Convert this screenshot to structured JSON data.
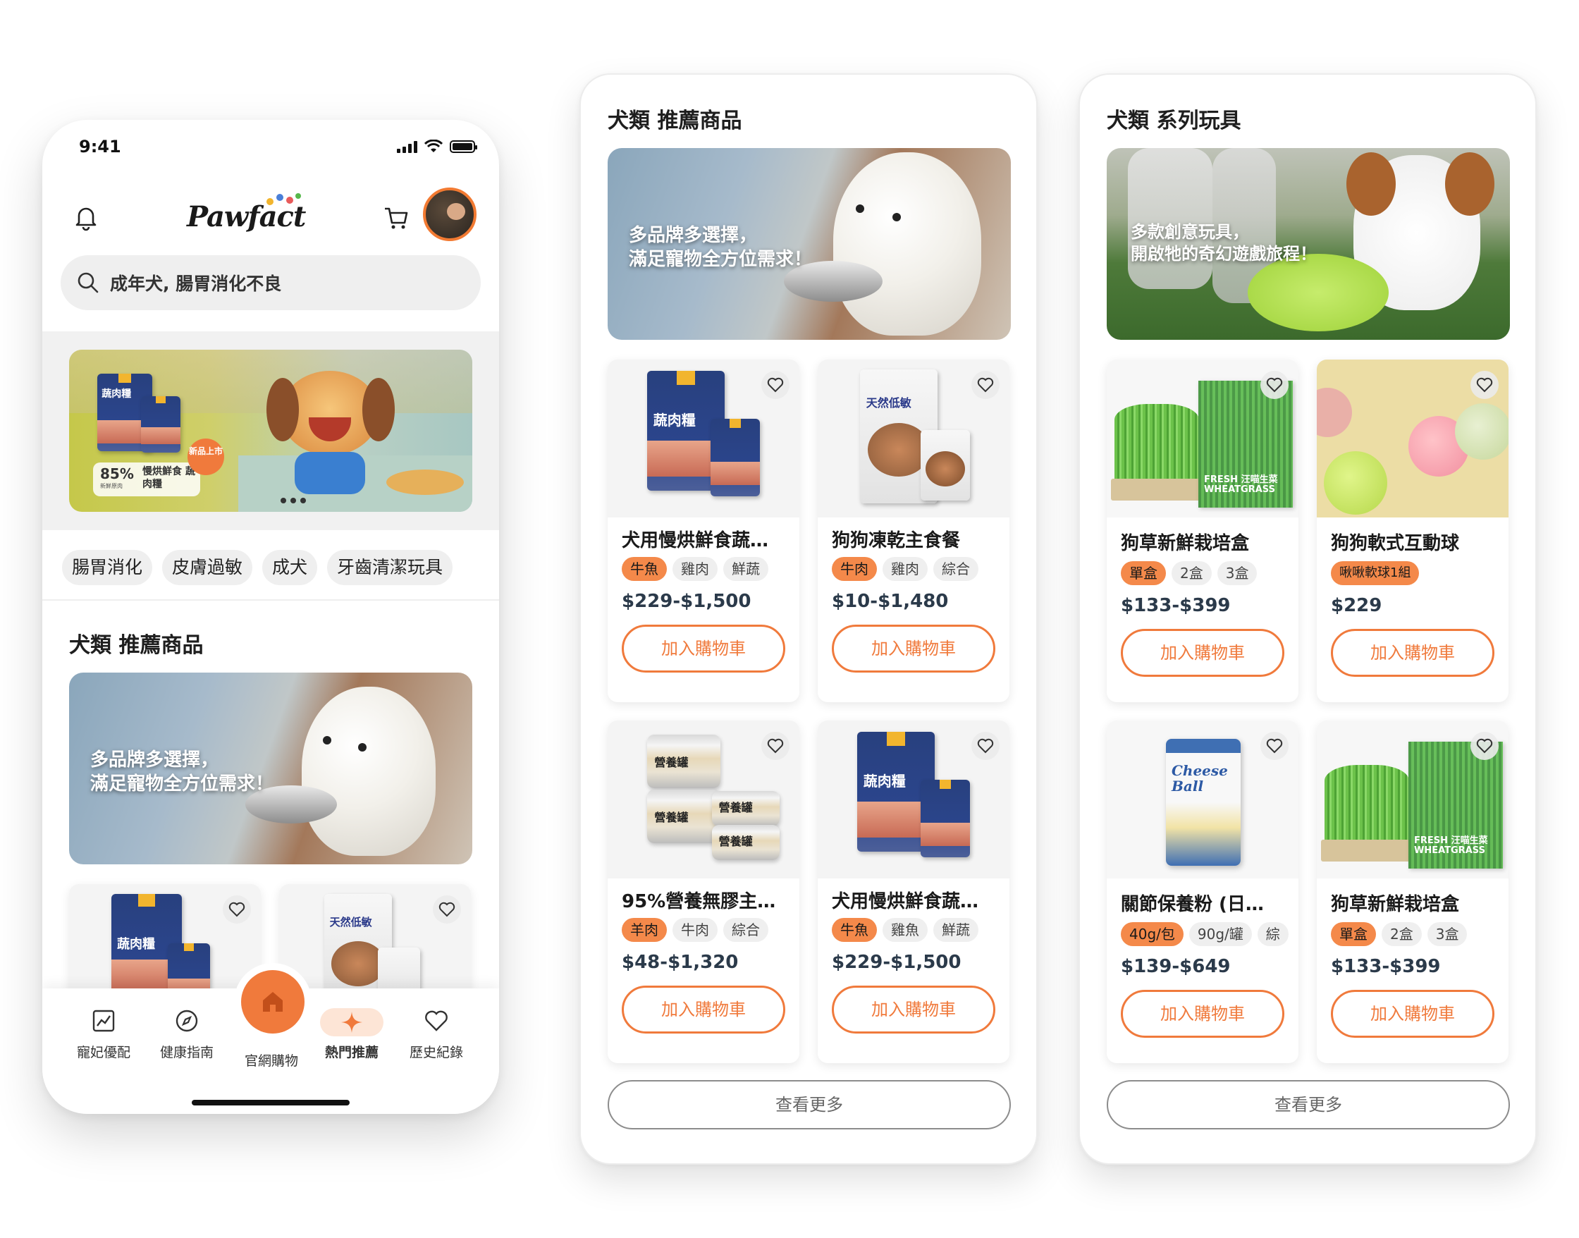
{
  "phone": {
    "status_time": "9:41",
    "logo": "Pawfact",
    "search_placeholder": "成年犬, 腸胃消化不良",
    "promo": {
      "pct": "85%",
      "small": "新鮮原肉",
      "name": "慢烘鮮食 蔬肉糧",
      "new_tag": "新品上市",
      "pkg_label": "蔬肉糧"
    },
    "chips": [
      "腸胃消化",
      "皮膚過敏",
      "成犬",
      "牙齒清潔玩具"
    ],
    "section_title": "犬類 推薦商品",
    "hero_text": [
      "多品牌多選擇，",
      "滿足寵物全方位需求！"
    ],
    "preview_pkg_labels": [
      "蔬肉糧",
      "天然低敏"
    ],
    "nav": [
      {
        "label": "寵妃優配",
        "icon": "chart-icon"
      },
      {
        "label": "健康指南",
        "icon": "compass-icon"
      },
      {
        "label": "官網購物",
        "icon": "home-icon"
      },
      {
        "label": "熱門推薦",
        "icon": "sparkle-icon"
      },
      {
        "label": "歷史紀錄",
        "icon": "heart-icon"
      }
    ]
  },
  "panel1": {
    "title": "犬類 推薦商品",
    "hero_text": [
      "多品牌多選擇，",
      "滿足寵物全方位需求！"
    ],
    "products": [
      {
        "name": "犬用慢烘鮮食蔬…",
        "tags": [
          "牛魚",
          "雞肉",
          "鮮蔬"
        ],
        "price": "$229-$1,500",
        "pkg": "蔬肉糧"
      },
      {
        "name": "狗狗凍乾主食餐",
        "tags": [
          "牛肉",
          "雞肉",
          "綜合"
        ],
        "price": "$10-$1,480",
        "pkg": "天然低敏"
      },
      {
        "name": "95%營養無膠主…",
        "tags": [
          "羊肉",
          "牛肉",
          "綜合"
        ],
        "price": "$48-$1,320",
        "pkg": "營養罐"
      },
      {
        "name": "犬用慢烘鮮食蔬…",
        "tags": [
          "牛魚",
          "雞魚",
          "鮮蔬"
        ],
        "price": "$229-$1,500",
        "pkg": "蔬肉糧"
      }
    ],
    "add_label": "加入購物車",
    "more_label": "查看更多"
  },
  "panel2": {
    "title": "犬類 系列玩具",
    "hero_text": [
      "多款創意玩具，",
      "開啟牠的奇幻遊戲旅程！"
    ],
    "products": [
      {
        "name": "狗草新鮮栽培盒",
        "tags": [
          "單盒",
          "2盒",
          "3盒"
        ],
        "price": "$133-$399",
        "pkg": "FRESH 汪喵生菜 WHEATGRASS"
      },
      {
        "name": "狗狗軟式互動球",
        "tags": [
          "啾啾軟球1組"
        ],
        "price": "$229"
      },
      {
        "name": "關節保養粉 (日…",
        "tags": [
          "40g/包",
          "90g/罐",
          "綜"
        ],
        "price": "$139-$649",
        "pkg": "Cheese Ball"
      },
      {
        "name": "狗草新鮮栽培盒",
        "tags": [
          "單盒",
          "2盒",
          "3盒"
        ],
        "price": "$133-$399",
        "pkg": "FRESH 汪喵生菜 WHEATGRASS"
      }
    ],
    "add_label": "加入購物車",
    "more_label": "查看更多"
  },
  "colors": {
    "accent": "#f07a3c",
    "tag_selected": "#f4894a",
    "price": "#2b3a4a"
  }
}
